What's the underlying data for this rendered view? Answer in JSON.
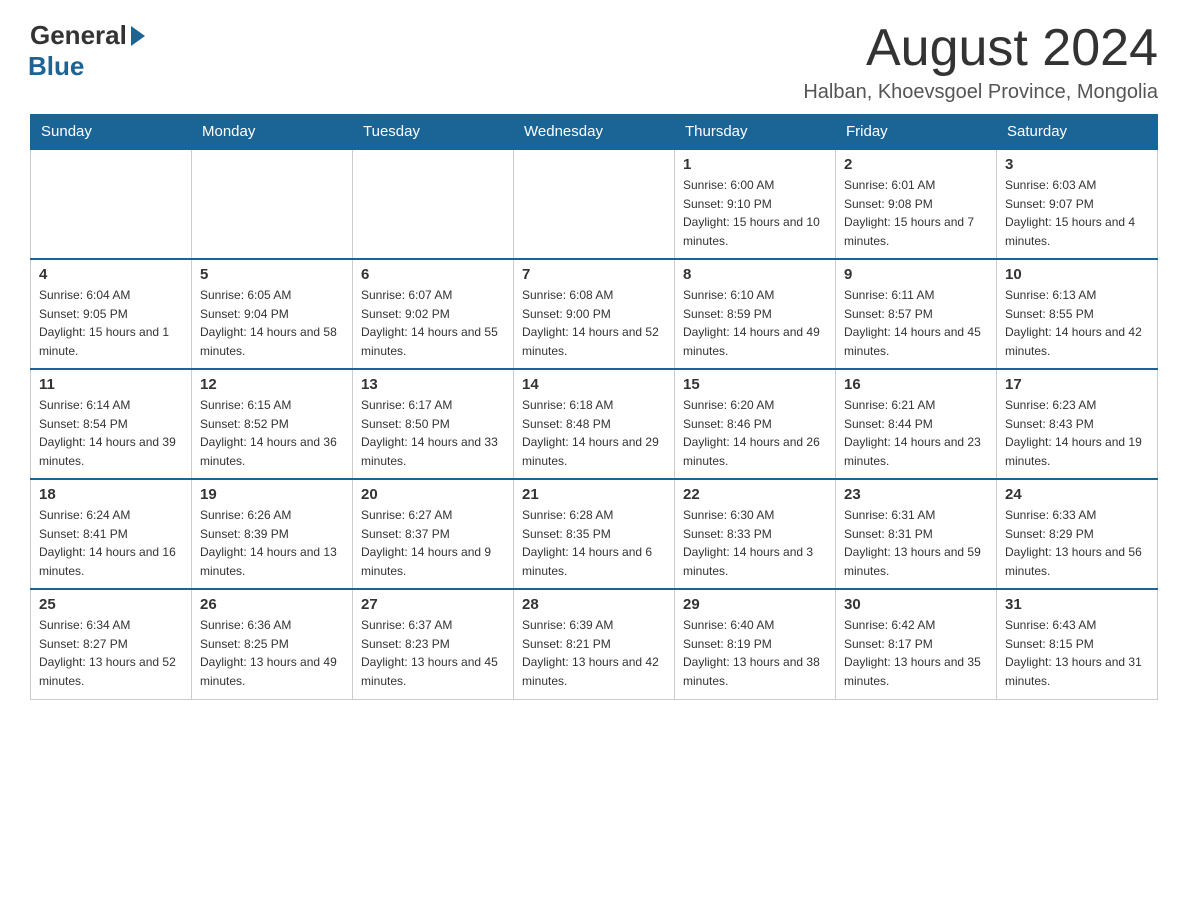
{
  "header": {
    "logo_text": "General",
    "logo_blue": "Blue",
    "month_title": "August 2024",
    "location": "Halban, Khoevsgoel Province, Mongolia"
  },
  "days_of_week": [
    "Sunday",
    "Monday",
    "Tuesday",
    "Wednesday",
    "Thursday",
    "Friday",
    "Saturday"
  ],
  "weeks": [
    [
      {
        "num": "",
        "info": ""
      },
      {
        "num": "",
        "info": ""
      },
      {
        "num": "",
        "info": ""
      },
      {
        "num": "",
        "info": ""
      },
      {
        "num": "1",
        "info": "Sunrise: 6:00 AM\nSunset: 9:10 PM\nDaylight: 15 hours and 10 minutes."
      },
      {
        "num": "2",
        "info": "Sunrise: 6:01 AM\nSunset: 9:08 PM\nDaylight: 15 hours and 7 minutes."
      },
      {
        "num": "3",
        "info": "Sunrise: 6:03 AM\nSunset: 9:07 PM\nDaylight: 15 hours and 4 minutes."
      }
    ],
    [
      {
        "num": "4",
        "info": "Sunrise: 6:04 AM\nSunset: 9:05 PM\nDaylight: 15 hours and 1 minute."
      },
      {
        "num": "5",
        "info": "Sunrise: 6:05 AM\nSunset: 9:04 PM\nDaylight: 14 hours and 58 minutes."
      },
      {
        "num": "6",
        "info": "Sunrise: 6:07 AM\nSunset: 9:02 PM\nDaylight: 14 hours and 55 minutes."
      },
      {
        "num": "7",
        "info": "Sunrise: 6:08 AM\nSunset: 9:00 PM\nDaylight: 14 hours and 52 minutes."
      },
      {
        "num": "8",
        "info": "Sunrise: 6:10 AM\nSunset: 8:59 PM\nDaylight: 14 hours and 49 minutes."
      },
      {
        "num": "9",
        "info": "Sunrise: 6:11 AM\nSunset: 8:57 PM\nDaylight: 14 hours and 45 minutes."
      },
      {
        "num": "10",
        "info": "Sunrise: 6:13 AM\nSunset: 8:55 PM\nDaylight: 14 hours and 42 minutes."
      }
    ],
    [
      {
        "num": "11",
        "info": "Sunrise: 6:14 AM\nSunset: 8:54 PM\nDaylight: 14 hours and 39 minutes."
      },
      {
        "num": "12",
        "info": "Sunrise: 6:15 AM\nSunset: 8:52 PM\nDaylight: 14 hours and 36 minutes."
      },
      {
        "num": "13",
        "info": "Sunrise: 6:17 AM\nSunset: 8:50 PM\nDaylight: 14 hours and 33 minutes."
      },
      {
        "num": "14",
        "info": "Sunrise: 6:18 AM\nSunset: 8:48 PM\nDaylight: 14 hours and 29 minutes."
      },
      {
        "num": "15",
        "info": "Sunrise: 6:20 AM\nSunset: 8:46 PM\nDaylight: 14 hours and 26 minutes."
      },
      {
        "num": "16",
        "info": "Sunrise: 6:21 AM\nSunset: 8:44 PM\nDaylight: 14 hours and 23 minutes."
      },
      {
        "num": "17",
        "info": "Sunrise: 6:23 AM\nSunset: 8:43 PM\nDaylight: 14 hours and 19 minutes."
      }
    ],
    [
      {
        "num": "18",
        "info": "Sunrise: 6:24 AM\nSunset: 8:41 PM\nDaylight: 14 hours and 16 minutes."
      },
      {
        "num": "19",
        "info": "Sunrise: 6:26 AM\nSunset: 8:39 PM\nDaylight: 14 hours and 13 minutes."
      },
      {
        "num": "20",
        "info": "Sunrise: 6:27 AM\nSunset: 8:37 PM\nDaylight: 14 hours and 9 minutes."
      },
      {
        "num": "21",
        "info": "Sunrise: 6:28 AM\nSunset: 8:35 PM\nDaylight: 14 hours and 6 minutes."
      },
      {
        "num": "22",
        "info": "Sunrise: 6:30 AM\nSunset: 8:33 PM\nDaylight: 14 hours and 3 minutes."
      },
      {
        "num": "23",
        "info": "Sunrise: 6:31 AM\nSunset: 8:31 PM\nDaylight: 13 hours and 59 minutes."
      },
      {
        "num": "24",
        "info": "Sunrise: 6:33 AM\nSunset: 8:29 PM\nDaylight: 13 hours and 56 minutes."
      }
    ],
    [
      {
        "num": "25",
        "info": "Sunrise: 6:34 AM\nSunset: 8:27 PM\nDaylight: 13 hours and 52 minutes."
      },
      {
        "num": "26",
        "info": "Sunrise: 6:36 AM\nSunset: 8:25 PM\nDaylight: 13 hours and 49 minutes."
      },
      {
        "num": "27",
        "info": "Sunrise: 6:37 AM\nSunset: 8:23 PM\nDaylight: 13 hours and 45 minutes."
      },
      {
        "num": "28",
        "info": "Sunrise: 6:39 AM\nSunset: 8:21 PM\nDaylight: 13 hours and 42 minutes."
      },
      {
        "num": "29",
        "info": "Sunrise: 6:40 AM\nSunset: 8:19 PM\nDaylight: 13 hours and 38 minutes."
      },
      {
        "num": "30",
        "info": "Sunrise: 6:42 AM\nSunset: 8:17 PM\nDaylight: 13 hours and 35 minutes."
      },
      {
        "num": "31",
        "info": "Sunrise: 6:43 AM\nSunset: 8:15 PM\nDaylight: 13 hours and 31 minutes."
      }
    ]
  ]
}
